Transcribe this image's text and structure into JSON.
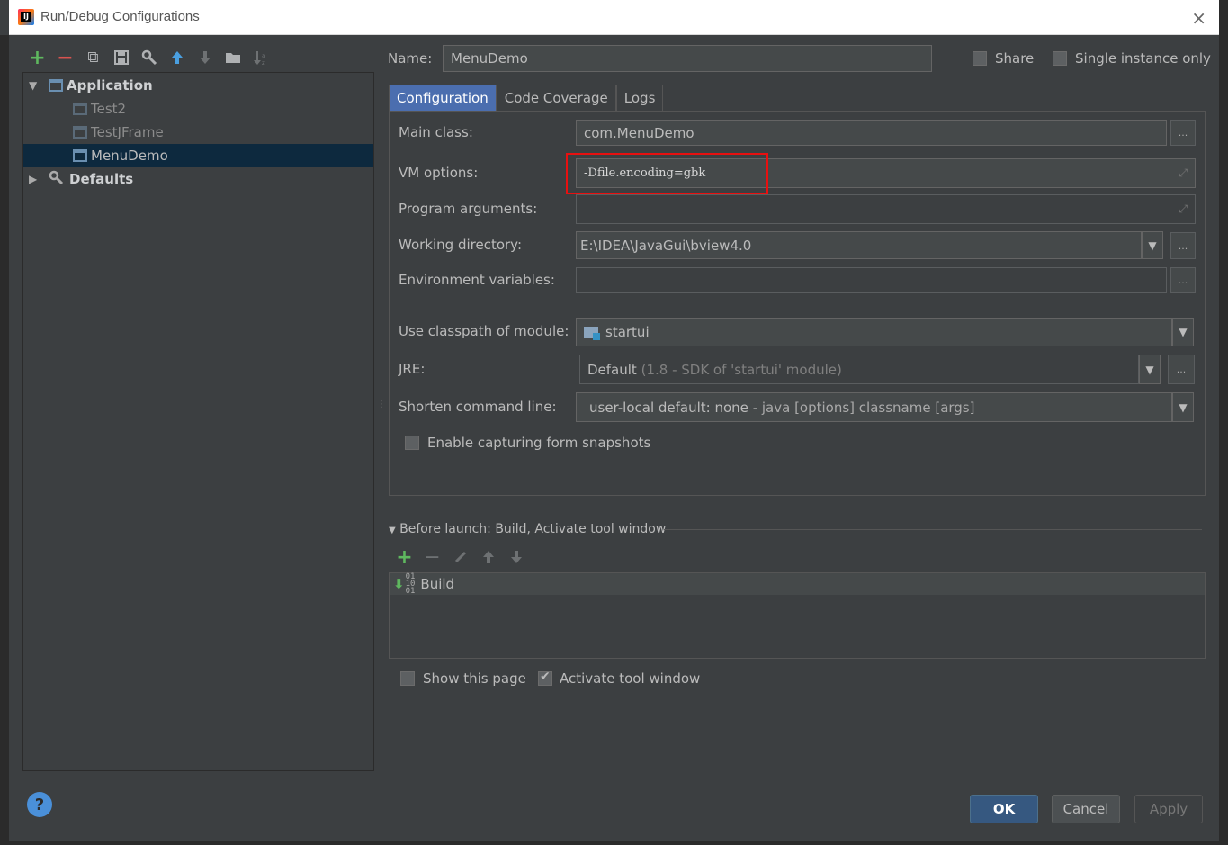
{
  "window": {
    "title": "Run/Debug Configurations",
    "close_icon": "×"
  },
  "toolbar": {
    "add": "+",
    "remove": "−",
    "copy": "⧉",
    "save": "💾",
    "wrench": "⚙",
    "up": "🡅",
    "down": "🡇",
    "folder": "▬",
    "sort": "↓ᶻ"
  },
  "tree": {
    "application_label": "Application",
    "items": [
      "Test2",
      "TestJFrame",
      "MenuDemo"
    ],
    "defaults_label": "Defaults"
  },
  "header": {
    "name_label": "Name:",
    "name_value": "MenuDemo",
    "share_label": "Share",
    "single_instance_label": "Single instance only"
  },
  "tabs": [
    "Configuration",
    "Code Coverage",
    "Logs"
  ],
  "form": {
    "main_class_label": "Main class:",
    "main_class_value": "com.MenuDemo",
    "vm_options_label": "VM options:",
    "vm_options_value": "-Dfile.encoding=gbk",
    "program_args_label": "Program arguments:",
    "program_args_value": "",
    "working_dir_label": "Working directory:",
    "working_dir_value": "E:\\IDEA\\JavaGui\\bview4.0",
    "env_vars_label": "Environment variables:",
    "env_vars_value": "",
    "classpath_label": "Use classpath of module:",
    "classpath_value": "startui",
    "jre_label": "JRE:",
    "jre_value": "Default",
    "jre_detail": "(1.8 - SDK of 'startui' module)",
    "shorten_label": "Shorten command line:",
    "shorten_value": "user-local default: none",
    "shorten_detail": "- java [options] classname [args]",
    "snapshots_label": "Enable capturing form snapshots",
    "dots": "...",
    "dropdown": "▼",
    "expand": "⤢"
  },
  "before_launch": {
    "title": "Before launch: Build, Activate tool window",
    "build_label": "Build",
    "show_page_label": "Show this page",
    "activate_label": "Activate tool window"
  },
  "buttons": {
    "ok": "OK",
    "cancel": "Cancel",
    "apply": "Apply",
    "help": "?"
  },
  "colors": {
    "accent": "#4b6eaf",
    "highlight": "#e81010",
    "background": "#3c3f41",
    "selection": "#0d293e"
  }
}
